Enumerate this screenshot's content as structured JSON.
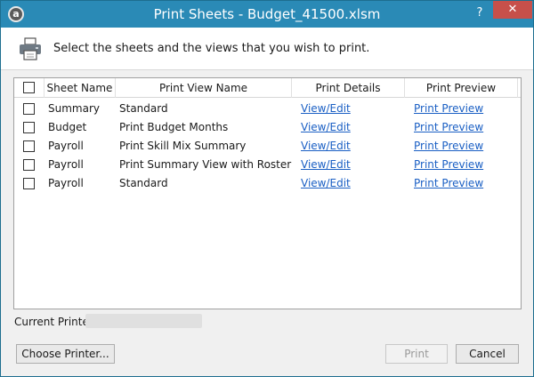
{
  "window": {
    "title": "Print Sheets - Budget_41500.xlsm",
    "app_icon_letter": "a",
    "help_label": "?",
    "close_label": "✕"
  },
  "header": {
    "instructions": "Select the sheets and the views that you wish to print."
  },
  "table": {
    "columns": [
      "Sheet Name",
      "Print View Name",
      "Print Details",
      "Print Preview"
    ],
    "rows": [
      {
        "sheet": "Summary",
        "view": "Standard",
        "details": "View/Edit",
        "preview": "Print Preview",
        "checked": false
      },
      {
        "sheet": "Budget",
        "view": "Print Budget Months",
        "details": "View/Edit",
        "preview": "Print Preview",
        "checked": false
      },
      {
        "sheet": "Payroll",
        "view": "Print Skill Mix Summary",
        "details": "View/Edit",
        "preview": "Print Preview",
        "checked": false
      },
      {
        "sheet": "Payroll",
        "view": "Print Summary View with Roster",
        "details": "View/Edit",
        "preview": "Print Preview",
        "checked": false
      },
      {
        "sheet": "Payroll",
        "view": "Standard",
        "details": "View/Edit",
        "preview": "Print Preview",
        "checked": false
      }
    ]
  },
  "printer": {
    "label": "Current Printer:"
  },
  "buttons": {
    "choose_printer": "Choose Printer...",
    "print": "Print",
    "cancel": "Cancel"
  },
  "colors": {
    "titlebar": "#2a8ab6",
    "close": "#c7504a",
    "link": "#1a5fc4"
  }
}
